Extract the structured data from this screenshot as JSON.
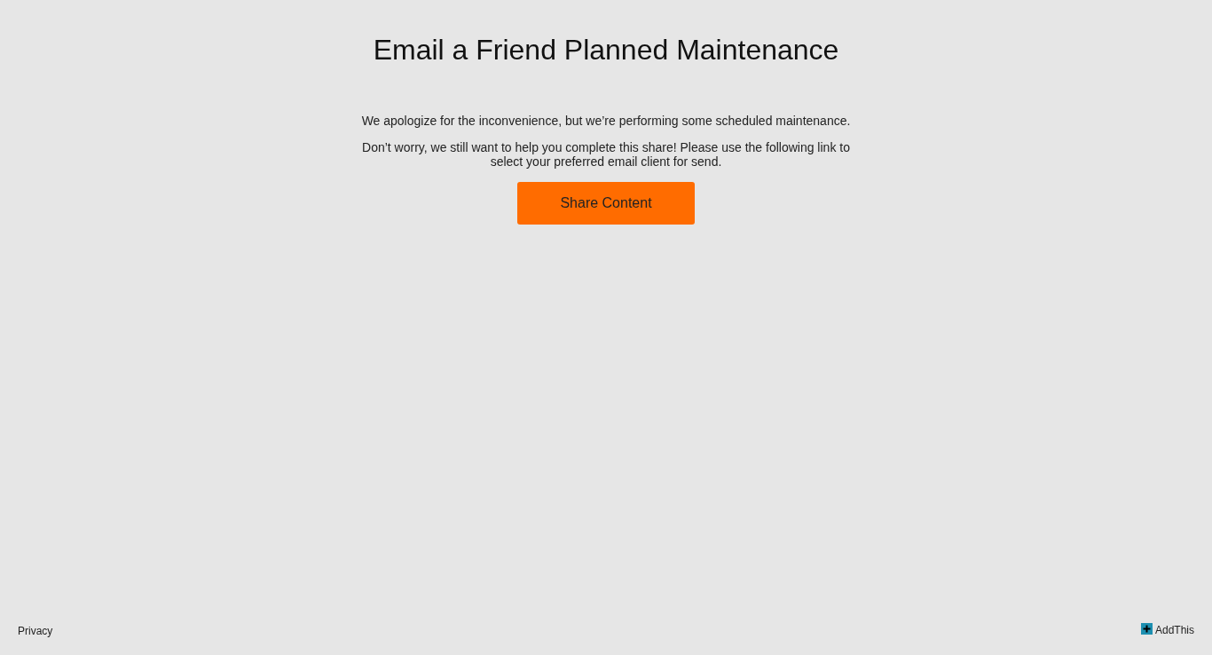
{
  "title": "Email a Friend Planned Maintenance",
  "paragraphs": [
    "We apologize for the inconvenience, but we’re performing some scheduled maintenance.",
    "Don’t worry, we still want to help you complete this share! Please use the following link to select your preferred email client for send."
  ],
  "button": "Share Content",
  "footer": {
    "privacy": "Privacy",
    "brand": "AddThis"
  }
}
